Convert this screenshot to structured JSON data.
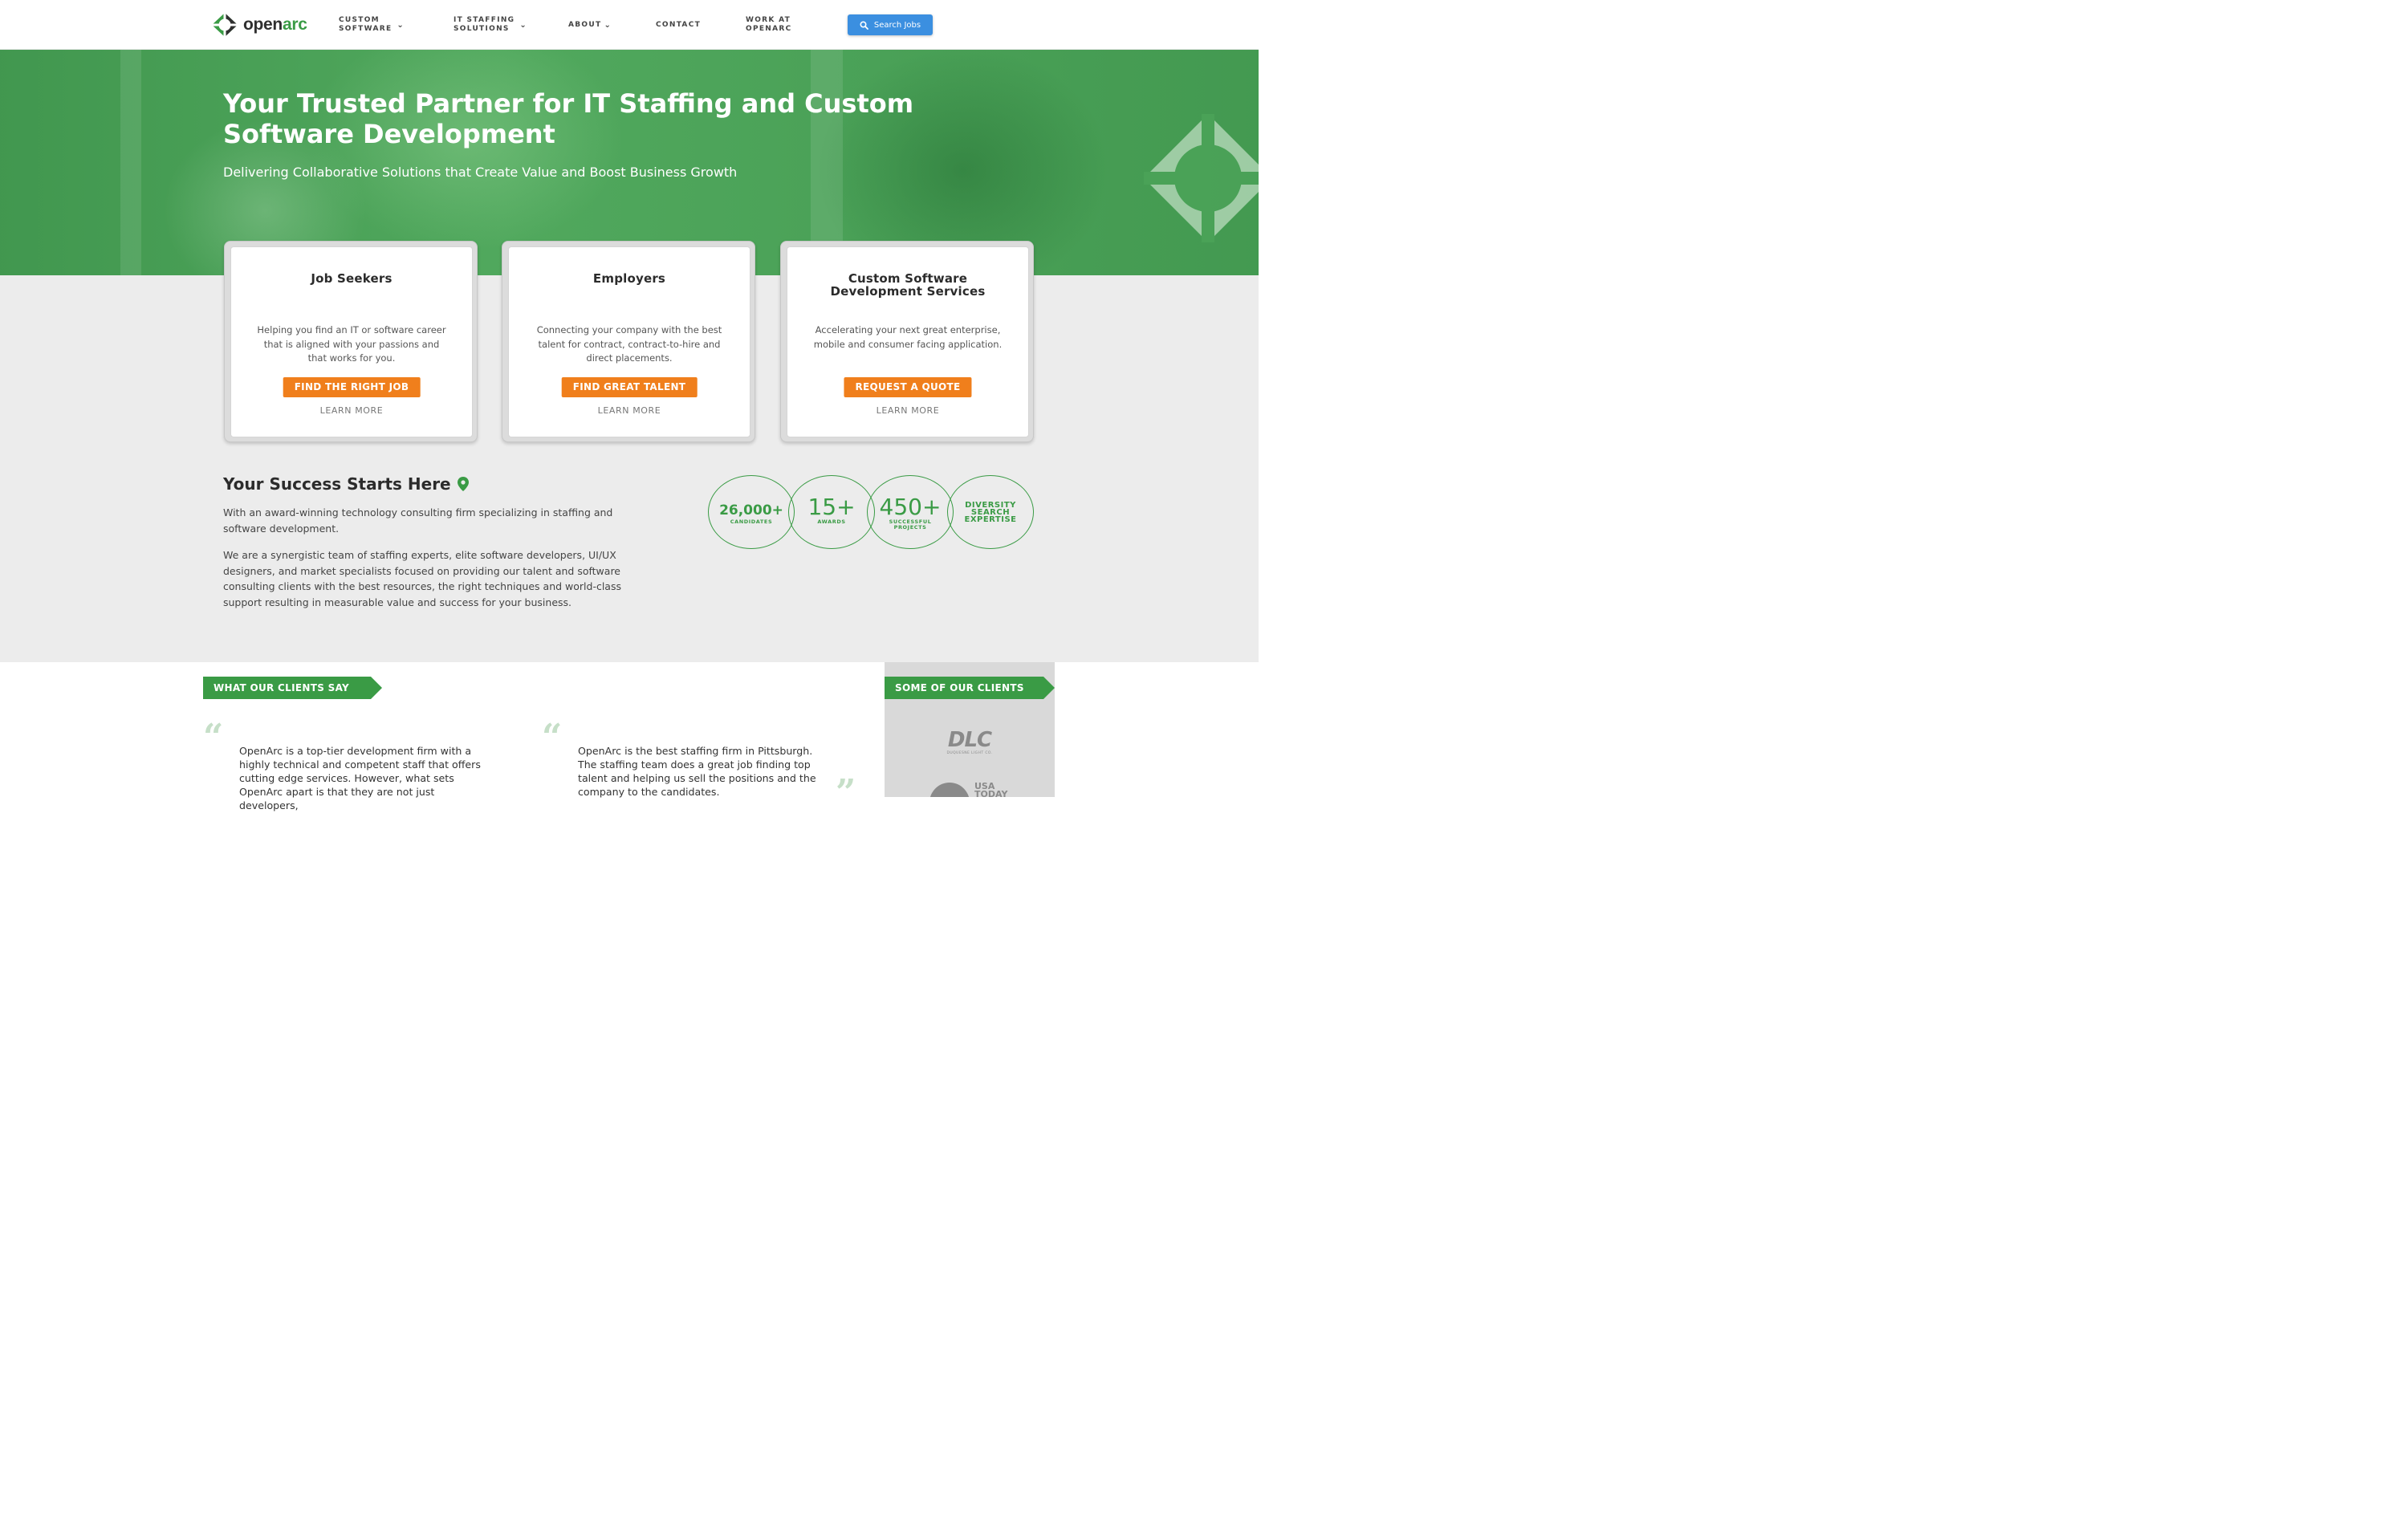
{
  "brand": {
    "name_part1": "open",
    "name_part2": "arc",
    "accent": "#3a9b45",
    "cta": "#f07f1c",
    "search_blue": "#3b8fe0"
  },
  "nav": {
    "items": [
      {
        "line1": "CUSTOM",
        "line2": "SOFTWARE",
        "has_dropdown": true
      },
      {
        "line1": "IT STAFFING",
        "line2": "SOLUTIONS",
        "has_dropdown": true
      },
      {
        "line1": "ABOUT",
        "line2": "",
        "has_dropdown": true
      },
      {
        "line1": "CONTACT",
        "line2": "",
        "has_dropdown": false
      },
      {
        "line1": "WORK AT",
        "line2": "OPENARC",
        "has_dropdown": false
      }
    ],
    "search_label": "Search Jobs"
  },
  "hero": {
    "title": "Your Trusted Partner for IT Staffing and Custom Software Development",
    "subtitle": "Delivering Collaborative Solutions that Create Value and Boost Business Growth"
  },
  "cards": [
    {
      "title": "Job Seekers",
      "desc": "Helping you find an IT or software career that is aligned with your passions and that works for you.",
      "button": "FIND THE RIGHT JOB",
      "link": "LEARN MORE"
    },
    {
      "title": "Employers",
      "desc": "Connecting your company with the best talent for contract, contract-to-hire and direct placements.",
      "button": "FIND GREAT TALENT",
      "link": "LEARN MORE"
    },
    {
      "title": "Custom Software Development Services",
      "desc": "Accelerating your next great enterprise, mobile and consumer facing application.",
      "button": "REQUEST A QUOTE",
      "link": "LEARN MORE"
    }
  ],
  "success": {
    "title": "Your Success Starts Here",
    "para1": "With an award-winning technology consulting firm specializing in staffing and software development.",
    "para2": "We are a synergistic team of staffing experts, elite software developers, UI/UX designers, and market specialists focused on providing our talent and software consulting clients with the best resources, the right techniques and world-class support resulting in measurable value and success for your business."
  },
  "stats": [
    {
      "value": "26,000+",
      "label": "CANDIDATES"
    },
    {
      "value": "15+",
      "label": "AWARDS"
    },
    {
      "value": "450+",
      "label": "SUCCESSFUL PROJECTS"
    },
    {
      "value": "",
      "label": "DIVERSITY SEARCH EXPERTISE"
    }
  ],
  "testimonials": {
    "heading": "WHAT OUR CLIENTS SAY",
    "quotes": [
      "OpenArc is a top-tier development firm with a highly technical and competent staff that offers cutting edge services. However, what sets OpenArc apart is that they are not just developers,",
      "OpenArc is the best staffing firm in Pittsburgh. The staffing team does a great job finding top talent and helping us sell the positions and the company to the candidates."
    ]
  },
  "clients": {
    "heading": "SOME OF OUR CLIENTS",
    "logos": [
      {
        "name": "DLC",
        "sub": "DUQUESNE LIGHT CO."
      },
      {
        "name": "USA TODAY",
        "sub": ""
      }
    ]
  }
}
